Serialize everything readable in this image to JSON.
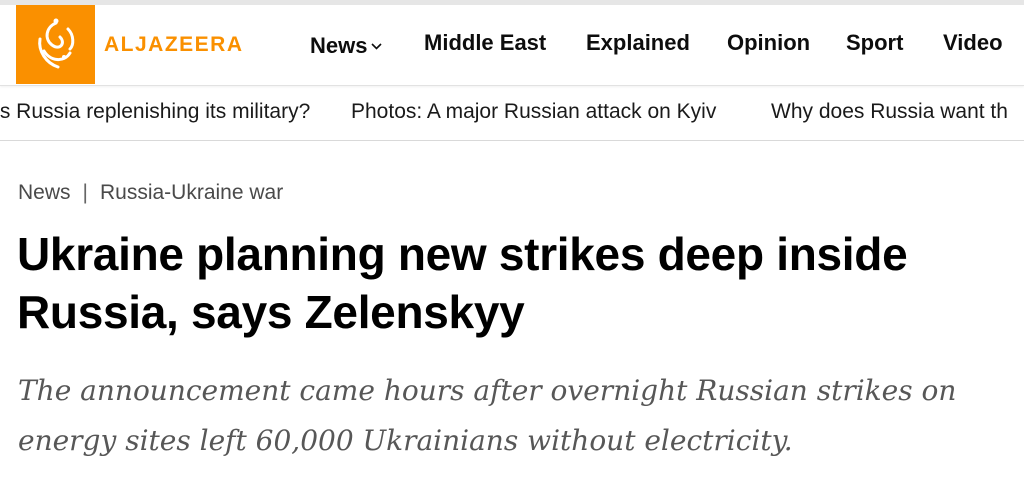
{
  "brand": {
    "name": "ALJAZEERA",
    "accent": "#fa9000"
  },
  "nav": {
    "items": [
      {
        "label": "News",
        "has_dropdown": true
      },
      {
        "label": "Middle East"
      },
      {
        "label": "Explained"
      },
      {
        "label": "Opinion"
      },
      {
        "label": "Sport"
      },
      {
        "label": "Video"
      }
    ]
  },
  "ticker": {
    "items": [
      "Is Russia replenishing its military?",
      "Photos: A major Russian attack on Kyiv",
      "Why does Russia want th"
    ]
  },
  "article": {
    "breadcrumb": {
      "section": "News",
      "separator": "|",
      "topic": "Russia-Ukraine war"
    },
    "headline": "Ukraine planning new strikes deep inside Russia, says Zelenskyy",
    "subheadline": "The announcement came hours after overnight Russian strikes on energy sites left 60,000 Ukrainians without electricity."
  }
}
